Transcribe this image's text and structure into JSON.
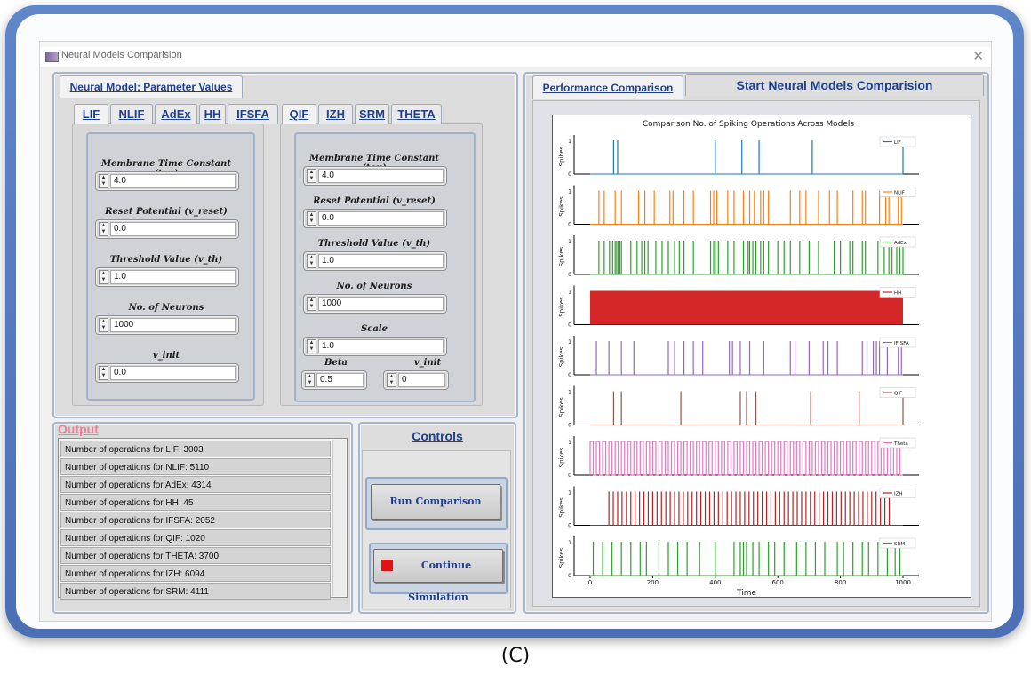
{
  "window": {
    "title": "Neural Models Comparision"
  },
  "left_panel": {
    "tab_label": "Neural Model: Parameter Values",
    "group1": {
      "tabs": [
        "LIF",
        "NLIF",
        "AdEx",
        "HH",
        "IFSFA"
      ],
      "fields": [
        {
          "label": "Membrane Time Constant (tau)",
          "value": "4.0"
        },
        {
          "label": "Reset Potential (v_reset)",
          "value": "0.0"
        },
        {
          "label": "Threshold Value (v_th)",
          "value": "1.0"
        },
        {
          "label": "No. of Neurons",
          "value": "1000"
        },
        {
          "label": "v_init",
          "value": "0.0"
        }
      ]
    },
    "group2": {
      "tabs": [
        "QIF",
        "IZH",
        "SRM",
        "THETA"
      ],
      "fields": [
        {
          "label": "Membrane Time Constant (tau)",
          "value": "4.0"
        },
        {
          "label": "Reset Potential (v_reset)",
          "value": "0.0"
        },
        {
          "label": "Threshold Value (v_th)",
          "value": "1.0"
        },
        {
          "label": "No. of Neurons",
          "value": "1000"
        },
        {
          "label": "Scale",
          "value": "1.0"
        }
      ],
      "beta": {
        "label": "Beta",
        "value": "0.5"
      },
      "v_init": {
        "label": "v_init",
        "value": "0"
      }
    }
  },
  "output": {
    "title": "Output",
    "rows": [
      "Number of operations for LIF: 3003",
      "Number of operations for NLIF: 5110",
      "Number of operations for AdEx: 4314",
      "Number of operations for HH: 45",
      "Number of operations for IFSFA: 2052",
      "Number of operations for QIF: 1020",
      "Number of operations for THETA: 3700",
      "Number of operations for IZH: 6094",
      "Number of operations for SRM: 4111"
    ]
  },
  "controls": {
    "title": "Controls",
    "run_label": "Run Comparison",
    "continue_label": "Continue Simulation",
    "stop_color": "#e31212"
  },
  "right_panel": {
    "tab_perf": "Performance Comparison",
    "tab_start": "Start Neural Models Comparision"
  },
  "chart_data": {
    "type": "line",
    "title": "Comparison No. of Spiking Operations Across Models",
    "xlabel": "Time",
    "ylabel": "Spikes",
    "xlim": [
      0,
      1000
    ],
    "ylim": [
      0,
      1
    ],
    "x_ticks": [
      "0",
      "200",
      "400",
      "600",
      "800",
      "1000"
    ],
    "y_ticks": [
      "0",
      "1"
    ],
    "series": [
      {
        "name": "LIF",
        "color": "#1f77b4",
        "spikes": [
          75,
          88,
          400,
          485,
          540,
          710,
          1000
        ]
      },
      {
        "name": "NLIF",
        "color": "#ff7f0e",
        "spikes": [
          28,
          45,
          80,
          100,
          155,
          175,
          205,
          255,
          265,
          300,
          330,
          385,
          395,
          405,
          440,
          460,
          490,
          510,
          525,
          545,
          555,
          570,
          640,
          670,
          690,
          730,
          765,
          790,
          840,
          870,
          880,
          925,
          945,
          955,
          985,
          995
        ]
      },
      {
        "name": "AdEx",
        "color": "#2ca02c",
        "spikes": [
          28,
          45,
          62,
          72,
          80,
          85,
          90,
          95,
          100,
          130,
          150,
          165,
          175,
          185,
          210,
          230,
          250,
          270,
          285,
          300,
          330,
          385,
          395,
          400,
          410,
          440,
          460,
          490,
          505,
          510,
          520,
          530,
          545,
          555,
          570,
          600,
          620,
          640,
          670,
          700,
          730,
          780,
          800,
          830,
          840,
          870,
          880,
          920,
          940,
          955,
          965,
          980,
          990,
          1000
        ]
      },
      {
        "name": "HH",
        "color": "#d62728",
        "block": [
          0,
          1000
        ]
      },
      {
        "name": "IF-SFA",
        "color": "#9467bd",
        "spikes": [
          20,
          60,
          100,
          140,
          250,
          270,
          300,
          330,
          360,
          445,
          455,
          480,
          510,
          555,
          640,
          655,
          700,
          745,
          760,
          790,
          870,
          885,
          905,
          915,
          925,
          950,
          985,
          995
        ]
      },
      {
        "name": "QIF",
        "color": "#8c564b",
        "spikes": [
          75,
          100,
          290,
          480,
          500,
          530,
          705,
          860,
          1000
        ]
      },
      {
        "name": "Theta",
        "color": "#e377c2",
        "periodic": {
          "start": 0,
          "step": 20,
          "end": 1000
        }
      },
      {
        "name": "IZH",
        "color": "#b22222",
        "periodic": {
          "start": 60,
          "step": 14,
          "end": 960
        }
      },
      {
        "name": "SRM",
        "color": "#2ca02c",
        "spikes": [
          10,
          40,
          70,
          100,
          130,
          160,
          180,
          220,
          250,
          280,
          310,
          350,
          400,
          460,
          480,
          490,
          500,
          520,
          540,
          570,
          590,
          620,
          660,
          690,
          720,
          750,
          790,
          810,
          840,
          870,
          890,
          920,
          950,
          975,
          990
        ]
      }
    ]
  }
}
